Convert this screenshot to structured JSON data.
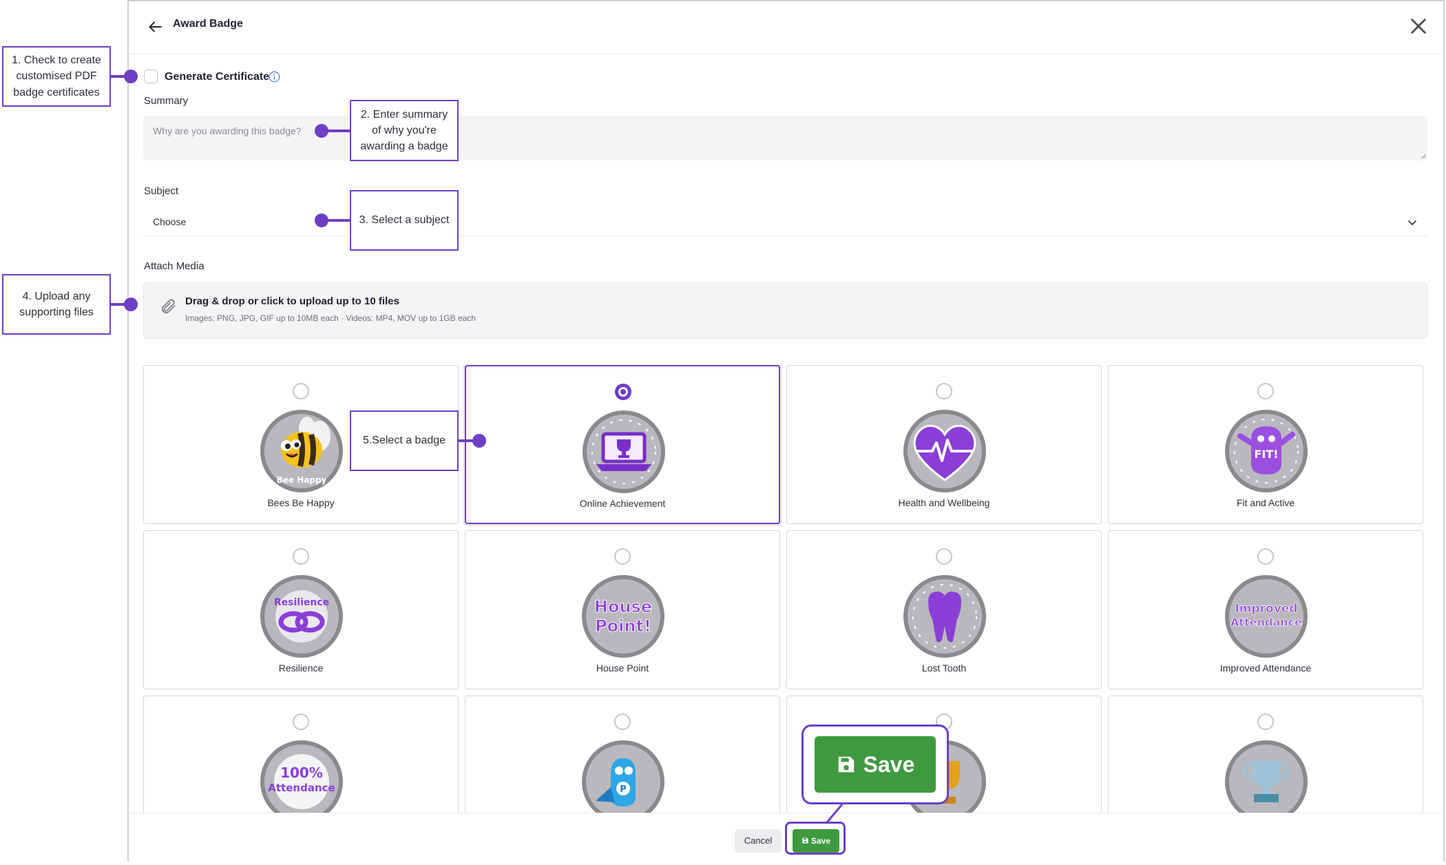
{
  "header": {
    "title": "Award Badge"
  },
  "certificate": {
    "label": "Generate Certificate"
  },
  "summary": {
    "label": "Summary",
    "placeholder": "Why are you awarding this badge?"
  },
  "subject": {
    "label": "Subject",
    "value": "Choose"
  },
  "media": {
    "label": "Attach Media",
    "title": "Drag & drop or click to upload up to 10 files",
    "subtitle": "Images: PNG, JPG, GIF up to 10MB each · Videos: MP4, MOV up to 1GB each"
  },
  "badges": [
    {
      "name": "Bees Be Happy",
      "selected": false,
      "art_text": "Bee Happy"
    },
    {
      "name": "Online Achievement",
      "selected": true
    },
    {
      "name": "Health and Wellbeing",
      "selected": false
    },
    {
      "name": "Fit and Active",
      "selected": false,
      "art_text": "FIT!"
    },
    {
      "name": "Resilience",
      "selected": false,
      "art_text": "Resilience"
    },
    {
      "name": "House Point",
      "selected": false,
      "art_text_1": "House",
      "art_text_2": "Point!"
    },
    {
      "name": "Lost Tooth",
      "selected": false
    },
    {
      "name": "Improved Attendance",
      "selected": false,
      "art_text_1": "Improved",
      "art_text_2": "Attendance"
    },
    {
      "name": "",
      "selected": false,
      "art_text_1": "100%",
      "art_text_2": "Attendance"
    },
    {
      "name": "",
      "selected": false,
      "art_text": "P"
    },
    {
      "name": "",
      "selected": false
    },
    {
      "name": "",
      "selected": false
    }
  ],
  "footer": {
    "cancel_label": "Cancel",
    "save_label": "Save"
  },
  "zoom": {
    "save_label": "Save"
  },
  "callouts": {
    "c1": [
      "1. Check to create",
      "customised PDF",
      "badge certificates"
    ],
    "c2": [
      "2. Enter summary",
      "of why you're",
      "awarding a badge"
    ],
    "c3": [
      "3. Select a subject"
    ],
    "c4": [
      "4. Upload any",
      "supporting files"
    ],
    "c5": [
      "5.Select a badge"
    ]
  },
  "colors": {
    "accent": "#6d3fc4",
    "save_green": "#3f9a3f",
    "badge_purple": "#8b3fd6",
    "badge_gray": "#b9b9bd"
  }
}
